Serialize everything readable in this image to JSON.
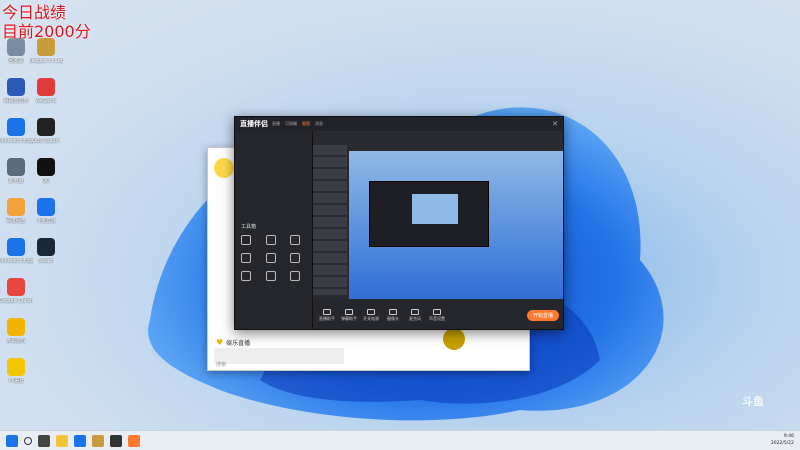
{
  "overlay": {
    "line1": "今日战绩",
    "line2": "目前2000分"
  },
  "desktop_icons": [
    {
      "name": "recycle-bin",
      "label": "回收站"
    },
    {
      "name": "app-icon",
      "label": "网易云音乐"
    },
    {
      "name": "app-icon",
      "label": "Microsoft Edge"
    },
    {
      "name": "app-icon",
      "label": "此电脑"
    },
    {
      "name": "app-icon",
      "label": "百度网盘"
    },
    {
      "name": "app-icon",
      "label": "Microsoft Edge"
    },
    {
      "name": "chrome-icon",
      "label": "Google Chrome"
    },
    {
      "name": "app-icon",
      "label": "腾讯游戏"
    },
    {
      "name": "app-icon",
      "label": "YY语音"
    },
    {
      "name": "lol-icon",
      "label": "League of Legends"
    },
    {
      "name": "app-icon",
      "label": "WeGame"
    },
    {
      "name": "app-icon",
      "label": "OBS Studio"
    },
    {
      "name": "qq-icon",
      "label": "QQ"
    },
    {
      "name": "app-icon",
      "label": "斗鱼直播"
    },
    {
      "name": "steam-icon",
      "label": "Steam"
    }
  ],
  "back_window": {
    "category": "娱乐直播",
    "search": "搜索"
  },
  "app_window": {
    "logo": "直播伴侣",
    "tabs": [
      "直播",
      "可测端",
      "截图",
      "消息"
    ],
    "sidebar_title": "工具箱",
    "go_live": "开始直播",
    "bottom_tools": [
      "直播助手",
      "弹幕助手",
      "开关电源",
      "摄像头",
      "麦克风",
      "声音设置"
    ]
  },
  "taskbar": {
    "time": "9:46",
    "date": "2022/5/22"
  },
  "watermark": "斗鱼"
}
